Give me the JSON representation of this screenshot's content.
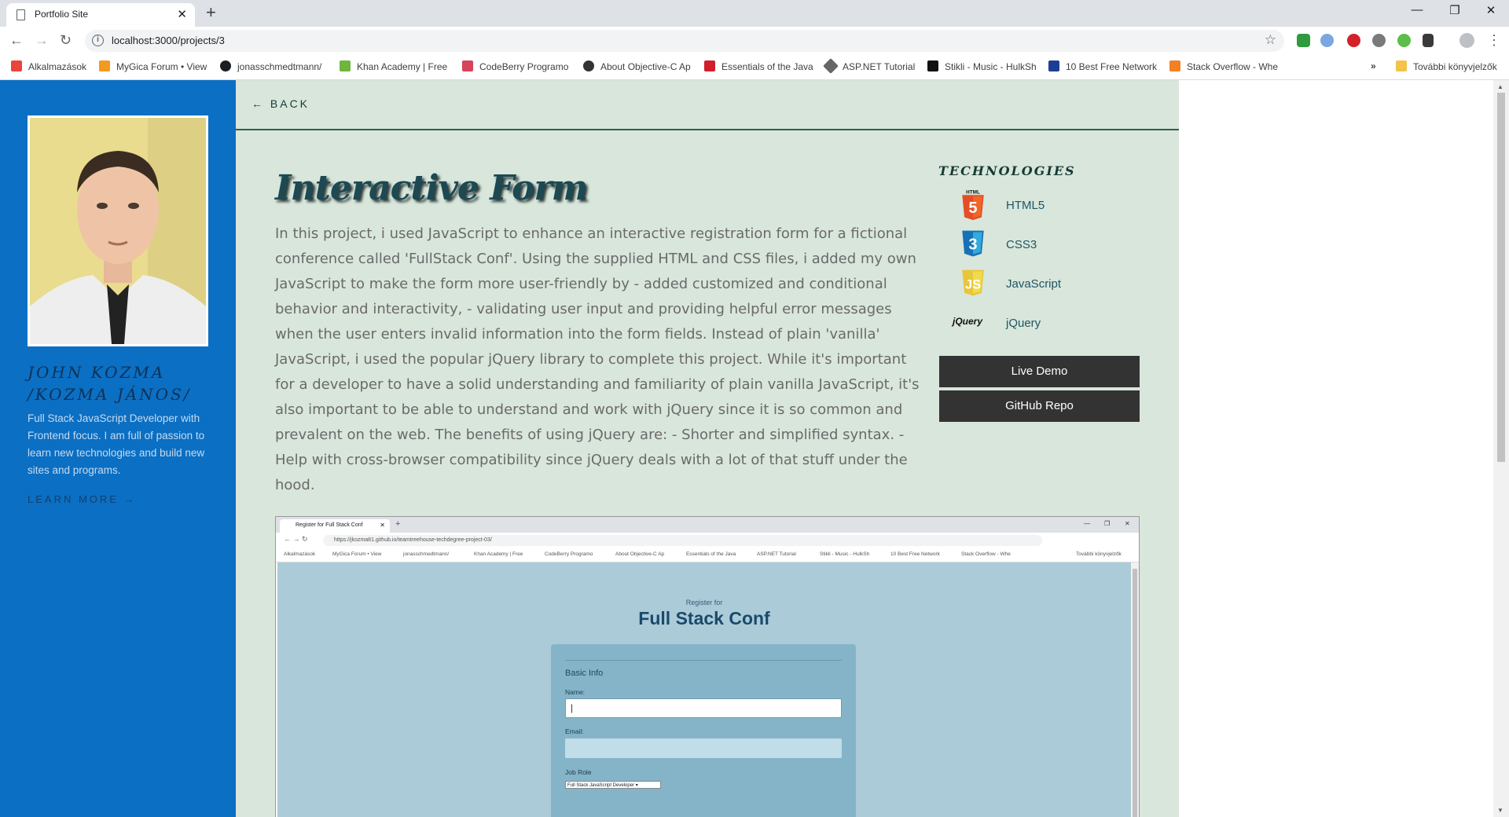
{
  "browser": {
    "tab_title": "Portfolio Site",
    "url": "localhost:3000/projects/3",
    "bookmarks": [
      "Alkalmazások",
      "MyGica Forum • View",
      "jonasschmedtmann/",
      "Khan Academy | Free",
      "CodeBerry Programo",
      "About Objective-C Ap",
      "Essentials of the Java",
      "ASP.NET Tutorial",
      "Stikli - Music - HulkSh",
      "10 Best Free Network",
      "Stack Overflow - Whe"
    ],
    "other_bookmarks": "További könyvjelzők"
  },
  "sidebar": {
    "name_line1": "JOHN KOZMA",
    "name_line2": "/KOZMA JÁNOS/",
    "description": "Full Stack JavaScript Developer with Frontend focus. I am full of passion to learn new technologies and build new sites and programs.",
    "learn_more": "LEARN MORE →"
  },
  "main": {
    "back": "← BACK",
    "title": "Interactive Form",
    "description": "In this project, i used JavaScript to enhance an interactive registration form for a fictional conference called 'FullStack Conf'. Using the supplied HTML and CSS files, i added my own JavaScript to make the form more user-friendly by - added customized and conditional behavior and interactivity, - validating user input and providing helpful error messages when the user enters invalid information into the form fields. Instead of plain 'vanilla' JavaScript, i used the popular jQuery library to complete this project. While it's important for a developer to have a solid understanding and familiarity of plain vanilla JavaScript, it's also important to be able to understand and work with jQuery since it is so common and prevalent on the web. The benefits of using jQuery are: - Shorter and simplified syntax. - Help with cross-browser compatibility since jQuery deals with a lot of that stuff under the hood.",
    "technologies_heading": "TECHNOLOGIES",
    "technologies": [
      "HTML5",
      "CSS3",
      "JavaScript",
      "jQuery"
    ],
    "html5_badge": "HTML",
    "jquery_logo": "jQuery",
    "live_demo": "Live Demo",
    "github_repo": "GitHub Repo"
  },
  "screenshot": {
    "tab_title": "Register for Full Stack Conf",
    "url": "https://jkozma81.github.io/teamtreehouse-techdegree-project-03/",
    "bookmarks": [
      "Alkalmazások",
      "MyGica Forum • View",
      "jonasschmedtmann/",
      "Khan Academy | Free",
      "CodeBerry Programo",
      "About Objective-C Ap",
      "Essentials of the Java",
      "ASP.NET Tutorial",
      "Stikli - Music - HulkSh",
      "10 Best Free Network",
      "Stack Overflow - Whe",
      "További könyvjelzők"
    ],
    "register_for": "Register for",
    "conf_title": "Full Stack Conf",
    "basic_info": "Basic Info",
    "name_label": "Name:",
    "email_label": "Email:",
    "job_role_label": "Job Role",
    "job_role_value": "Full Stack JavaScript Developer ▾"
  },
  "colors": {
    "sidebar_bg": "#0b6fc3",
    "main_bg": "#d9e6db",
    "button_bg": "#333333",
    "html5": "#e44d26",
    "css3": "#1572b6",
    "javascript": "#f0db4f"
  }
}
